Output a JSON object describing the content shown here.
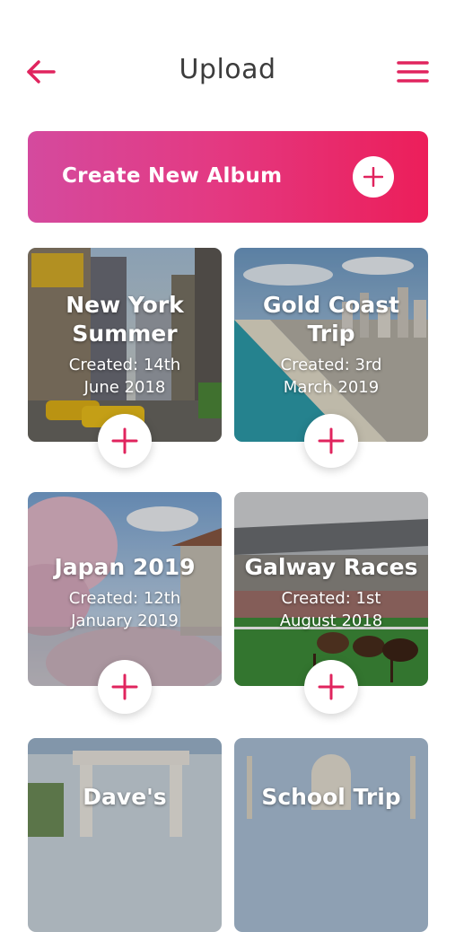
{
  "header": {
    "title": "Upload",
    "back_icon": "arrow-left-icon",
    "menu_icon": "hamburger-menu-icon"
  },
  "create_album": {
    "label": "Create New Album",
    "icon": "plus-icon"
  },
  "albums": [
    {
      "title": "New York Summer",
      "created": "Created: 14th June 2018",
      "scene": "city street"
    },
    {
      "title": "Gold Coast Trip",
      "created": "Created: 3rd March 2019",
      "scene": "beach coastline"
    },
    {
      "title": "Japan 2019",
      "created": "Created: 12th January 2019",
      "scene": "cherry blossoms"
    },
    {
      "title": "Galway Races",
      "created": "Created: 1st August 2018",
      "scene": "horse race"
    },
    {
      "title": "Dave's",
      "created": "",
      "scene": "wedding arch"
    },
    {
      "title": "School Trip",
      "created": "",
      "scene": "taj mahal"
    }
  ],
  "colors": {
    "accent": "#e0245e",
    "gradient_start": "#d44a9e",
    "gradient_end": "#ec1e5a",
    "title_text": "#3c3c3c"
  }
}
